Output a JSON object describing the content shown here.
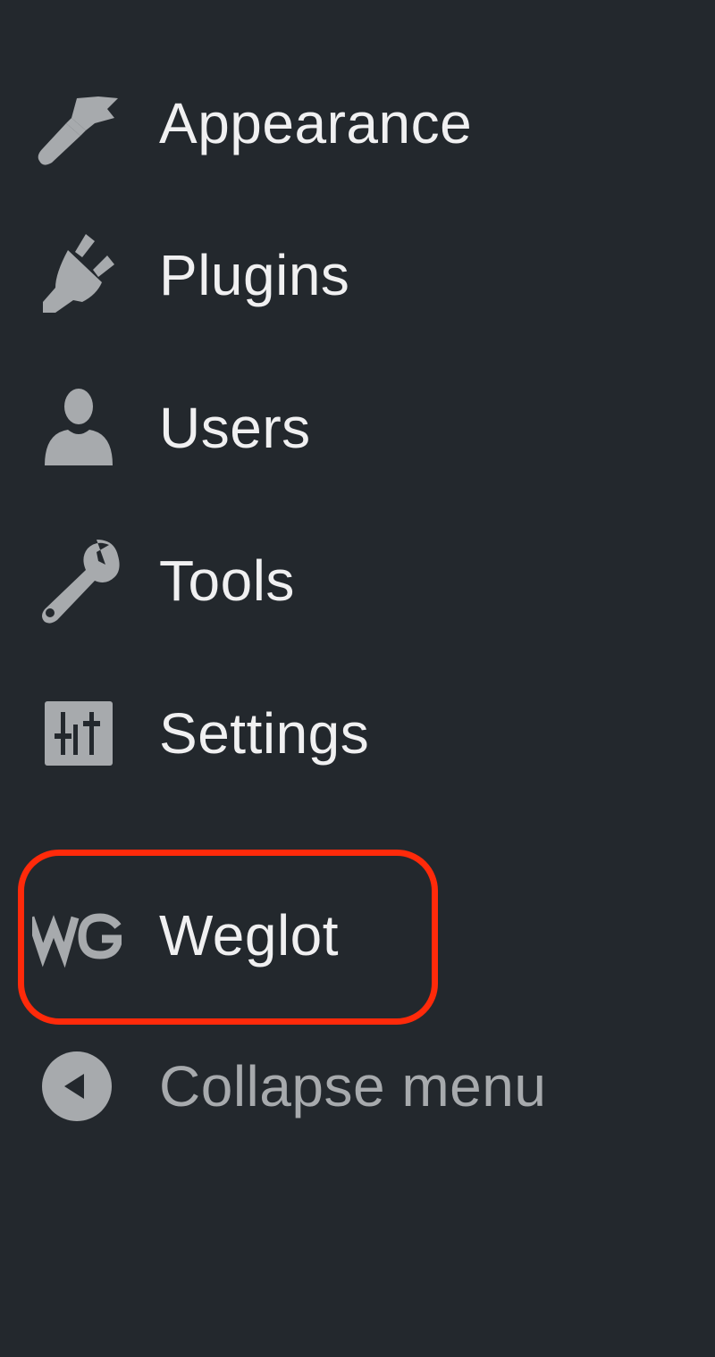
{
  "sidebar": {
    "items": [
      {
        "id": "appearance",
        "label": "Appearance",
        "icon": "paintbrush-icon"
      },
      {
        "id": "plugins",
        "label": "Plugins",
        "icon": "plug-icon"
      },
      {
        "id": "users",
        "label": "Users",
        "icon": "user-icon"
      },
      {
        "id": "tools",
        "label": "Tools",
        "icon": "wrench-icon"
      },
      {
        "id": "settings",
        "label": "Settings",
        "icon": "sliders-icon"
      },
      {
        "id": "weglot",
        "label": "Weglot",
        "icon": "weglot-logo-icon"
      }
    ],
    "collapse": {
      "label": "Collapse menu",
      "icon": "collapse-arrow-icon"
    },
    "highlighted_item": "weglot"
  },
  "colors": {
    "background": "#23282d",
    "label": "#f0f0f1",
    "icon": "#a7aaad",
    "muted_label": "#a7aaad",
    "highlight_outline": "#ff2a0a"
  }
}
